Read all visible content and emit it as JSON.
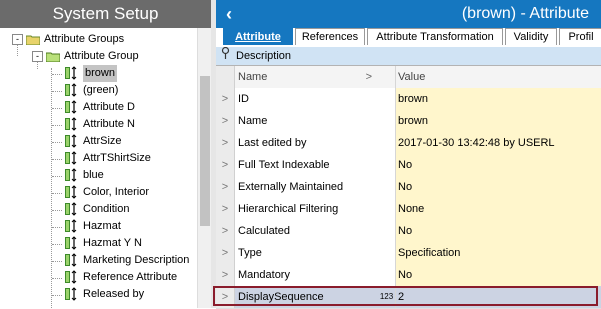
{
  "left": {
    "title": "System Setup",
    "tree": {
      "root": {
        "label": "Attribute Groups",
        "expander": "-"
      },
      "group": {
        "label": "Attribute Group",
        "expander": "-"
      },
      "items": [
        {
          "label": "brown",
          "selected": true
        },
        {
          "label": "(green)"
        },
        {
          "label": "Attribute D"
        },
        {
          "label": "Attribute N"
        },
        {
          "label": "AttrSize"
        },
        {
          "label": "AttrTShirtSize"
        },
        {
          "label": "blue"
        },
        {
          "label": "Color, Interior"
        },
        {
          "label": "Condition"
        },
        {
          "label": "Hazmat"
        },
        {
          "label": "Hazmat Y N"
        },
        {
          "label": "Marketing Description"
        },
        {
          "label": "Reference Attribute"
        },
        {
          "label": "Released by"
        }
      ]
    }
  },
  "right": {
    "back_glyph": "‹",
    "title": "(brown) - Attribute",
    "tabs": [
      {
        "label": "Attribute",
        "active": true
      },
      {
        "label": "References"
      },
      {
        "label": "Attribute Transformation"
      },
      {
        "label": "Validity"
      },
      {
        "label": "Profil"
      }
    ],
    "section": {
      "pin_icon": "pin-icon",
      "label": "Description"
    },
    "grid": {
      "header": {
        "name": "Name",
        "value": "Value",
        "chevron": ">"
      },
      "row_chevron": ">",
      "rows": [
        {
          "name": "ID",
          "type": "",
          "value": "brown"
        },
        {
          "name": "Name",
          "type": "",
          "value": "brown"
        },
        {
          "name": "Last edited by",
          "type": "",
          "value": "2017-01-30 13:42:48 by USERL"
        },
        {
          "name": "Full Text Indexable",
          "type": "",
          "value": "No"
        },
        {
          "name": "Externally Maintained",
          "type": "",
          "value": "No"
        },
        {
          "name": "Hierarchical Filtering",
          "type": "",
          "value": "None"
        },
        {
          "name": "Calculated",
          "type": "",
          "value": "No"
        },
        {
          "name": "Type",
          "type": "",
          "value": "Specification"
        },
        {
          "name": "Mandatory",
          "type": "",
          "value": "No"
        },
        {
          "name": "DisplaySequence",
          "type": "123",
          "value": "2"
        }
      ]
    }
  },
  "colors": {
    "accent": "#1577c0",
    "left_header": "#6b6b6b",
    "value_bg": "#fff6cc",
    "highlight_box": "#8a1c2c"
  }
}
